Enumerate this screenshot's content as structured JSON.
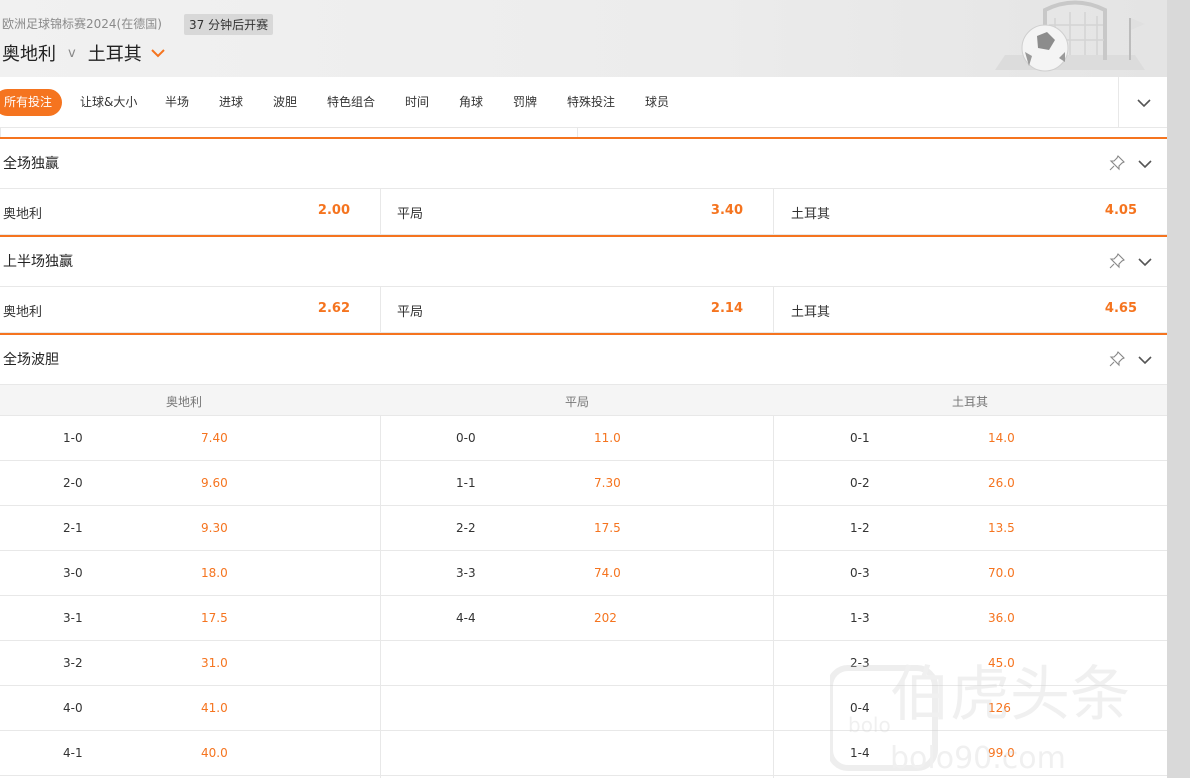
{
  "header": {
    "tournament": "欧洲足球锦标赛2024(在德国)",
    "countdown": "37 分钟后开赛",
    "home_team": "奥地利",
    "vs": "v",
    "away_team": "土耳其"
  },
  "tabs": [
    "所有投注",
    "让球&大小",
    "半场",
    "进球",
    "波胆",
    "特色组合",
    "时间",
    "角球",
    "罚牌",
    "特殊投注",
    "球员"
  ],
  "markets": {
    "fulltime": {
      "title": "全场独赢",
      "home": {
        "name": "奥地利",
        "odds": "2.00"
      },
      "draw": {
        "name": "平局",
        "odds": "3.40"
      },
      "away": {
        "name": "土耳其",
        "odds": "4.05"
      }
    },
    "firsthalf": {
      "title": "上半场独赢",
      "home": {
        "name": "奥地利",
        "odds": "2.62"
      },
      "draw": {
        "name": "平局",
        "odds": "2.14"
      },
      "away": {
        "name": "土耳其",
        "odds": "4.65"
      }
    },
    "correct_score": {
      "title": "全场波胆",
      "columns": [
        "奥地利",
        "平局",
        "土耳其"
      ],
      "rows": [
        {
          "h": "1-0",
          "ho": "7.40",
          "d": "0-0",
          "do": "11.0",
          "a": "0-1",
          "ao": "14.0"
        },
        {
          "h": "2-0",
          "ho": "9.60",
          "d": "1-1",
          "do": "7.30",
          "a": "0-2",
          "ao": "26.0"
        },
        {
          "h": "2-1",
          "ho": "9.30",
          "d": "2-2",
          "do": "17.5",
          "a": "1-2",
          "ao": "13.5"
        },
        {
          "h": "3-0",
          "ho": "18.0",
          "d": "3-3",
          "do": "74.0",
          "a": "0-3",
          "ao": "70.0"
        },
        {
          "h": "3-1",
          "ho": "17.5",
          "d": "4-4",
          "do": "202",
          "a": "1-3",
          "ao": "36.0"
        },
        {
          "h": "3-2",
          "ho": "31.0",
          "d": "",
          "do": "",
          "a": "2-3",
          "ao": "45.0"
        },
        {
          "h": "4-0",
          "ho": "41.0",
          "d": "",
          "do": "",
          "a": "0-4",
          "ao": "126"
        },
        {
          "h": "4-1",
          "ho": "40.0",
          "d": "",
          "do": "",
          "a": "1-4",
          "ao": "99.0"
        }
      ]
    }
  },
  "colors": {
    "accent": "#f5741f",
    "divider": "#e8e8e8"
  }
}
